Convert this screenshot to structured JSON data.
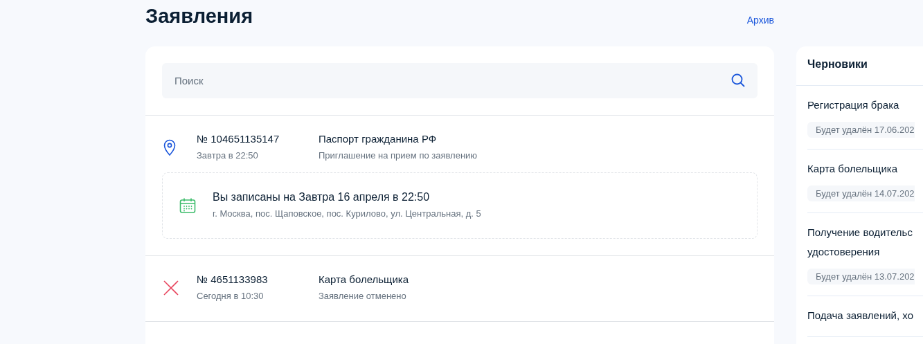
{
  "title": "Заявления",
  "archive_link": "Архив",
  "search": {
    "placeholder": "Поиск"
  },
  "applications": [
    {
      "kind": "appointment",
      "number": "№ 104651135147",
      "time": "Завтра в 22:50",
      "service": "Паспорт гражданина РФ",
      "status": "Приглашение на прием по заявлению",
      "appointment": {
        "heading": "Вы записаны на Завтра 16 апреля в 22:50",
        "address": "г. Москва, пос. Щаповское, пос. Курилово, ул. Центральная, д. 5"
      }
    },
    {
      "kind": "cancelled",
      "number": "№ 4651133983",
      "time": "Сегодня в 10:30",
      "service": "Карта болельщика",
      "status": "Заявление отменено"
    }
  ],
  "drafts": {
    "title": "Черновики",
    "items": [
      {
        "name": "Регистрация брака",
        "deletion": "Будет удалён 17.06.202"
      },
      {
        "name": "Карта болельщика",
        "deletion": "Будет удалён 14.07.202"
      },
      {
        "name": "Получение водительс удостоверения",
        "deletion": "Будет удалён 13.07.202"
      },
      {
        "name": "Подача заявлений, хо"
      }
    ]
  }
}
